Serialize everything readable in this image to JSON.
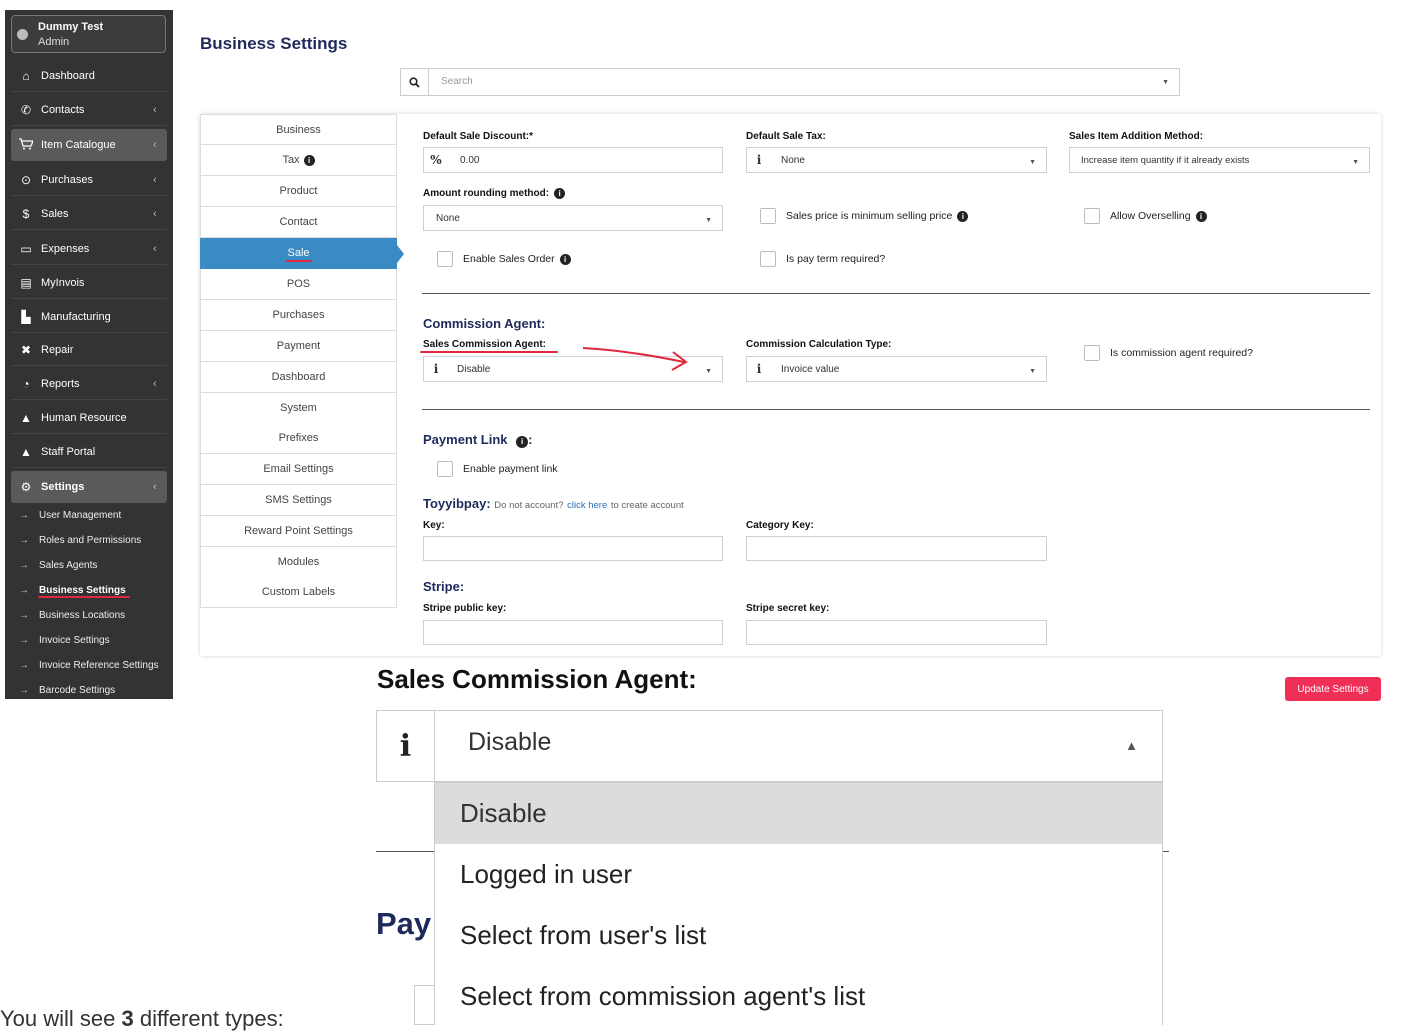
{
  "user": {
    "name": "Dummy Test",
    "role": "Admin"
  },
  "nav": [
    {
      "label": "Dashboard",
      "icon": "home-icon",
      "glyph": "⌂",
      "chev": ""
    },
    {
      "label": "Contacts",
      "icon": "phone-icon",
      "glyph": "✆",
      "chev": "‹"
    },
    {
      "label": "Item Catalogue",
      "icon": "cart-icon",
      "glyph": "🛒",
      "chev": "‹"
    },
    {
      "label": "Purchases",
      "icon": "circle-chevron-icon",
      "glyph": "⊙",
      "chev": "‹"
    },
    {
      "label": "Sales",
      "icon": "dollar-icon",
      "glyph": "$",
      "chev": "‹"
    },
    {
      "label": "Expenses",
      "icon": "wallet-icon",
      "glyph": "▭",
      "chev": "‹"
    },
    {
      "label": "MyInvois",
      "icon": "document-icon",
      "glyph": "▤",
      "chev": ""
    },
    {
      "label": "Manufacturing",
      "icon": "factory-icon",
      "glyph": "▙",
      "chev": ""
    },
    {
      "label": "Repair",
      "icon": "tools-icon",
      "glyph": "✖",
      "chev": ""
    },
    {
      "label": "Reports",
      "icon": "pie-chart-icon",
      "glyph": "◔",
      "chev": "‹"
    },
    {
      "label": "Human Resource",
      "icon": "person-icon",
      "glyph": "▲",
      "chev": ""
    },
    {
      "label": "Staff Portal",
      "icon": "person-icon",
      "glyph": "▲",
      "chev": ""
    },
    {
      "label": "Settings",
      "icon": "gear-icon",
      "glyph": "⚙",
      "chev": "‹"
    }
  ],
  "settings_sub": [
    "User Management",
    "Roles and Permissions",
    "Sales Agents",
    "Business Settings",
    "Business Locations",
    "Invoice Settings",
    "Invoice Reference Settings",
    "Barcode Settings"
  ],
  "page_title": "Business Settings",
  "search": {
    "placeholder": "Search"
  },
  "tabs": [
    "Business",
    "Tax",
    "Product",
    "Contact",
    "Sale",
    "POS",
    "Purchases",
    "Payment",
    "Dashboard",
    "System",
    "Prefixes",
    "Email Settings",
    "SMS Settings",
    "Reward Point Settings",
    "Modules",
    "Custom Labels"
  ],
  "sale": {
    "default_discount_label": "Default Sale Discount:*",
    "default_discount_symbol": "%",
    "default_discount_value": "0.00",
    "default_tax_label": "Default Sale Tax:",
    "default_tax_value": "None",
    "addition_method_label": "Sales Item Addition Method:",
    "addition_method_value": "Increase item quantity if it already exists",
    "rounding_label": "Amount rounding method:",
    "rounding_value": "None",
    "min_price_label": "Sales price is minimum selling price",
    "overselling_label": "Allow Overselling",
    "sales_order_label": "Enable Sales Order",
    "pay_term_label": "Is pay term required?",
    "commission_title": "Commission Agent:",
    "commission_agent_label": "Sales Commission Agent:",
    "commission_agent_value": "Disable",
    "commission_calc_label": "Commission Calculation Type:",
    "commission_calc_value": "Invoice value",
    "agent_required_label": "Is commission agent required?",
    "payment_link_title": "Payment Link",
    "enable_payment_link_label": "Enable payment link",
    "toyyibpay_title": "Toyyibpay:",
    "toyyibpay_note": "Do not account?",
    "toyyibpay_link": "click here",
    "toyyibpay_note2": "to create account",
    "key_label": "Key:",
    "category_key_label": "Category Key:",
    "stripe_title": "Stripe:",
    "stripe_public_label": "Stripe public key:",
    "stripe_secret_label": "Stripe secret key:"
  },
  "update_button": "Update Settings",
  "zoom": {
    "title": "Sales Commission Agent:",
    "selected": "Disable",
    "options": [
      "Disable",
      "Logged in user",
      "Select from user's list",
      "Select from commission agent's list"
    ],
    "pay_partial": "Pay",
    "note": "You will see 3 different types:"
  },
  "colors": {
    "sidebar": "#333333",
    "active_tab": "#3a8bc4",
    "title": "#1f2a5c",
    "update_button": "#ef2f55",
    "annotation": "#e0283c"
  }
}
